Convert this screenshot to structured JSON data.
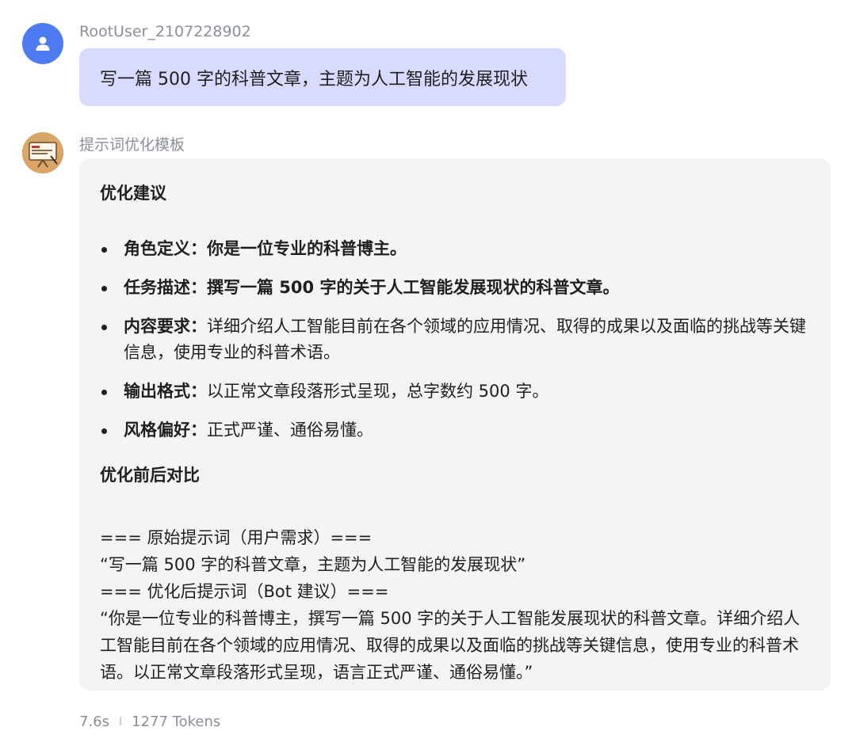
{
  "user": {
    "name": "RootUser_2107228902",
    "message": "写一篇 500 字的科普文章，主题为人工智能的发展现状"
  },
  "bot": {
    "name": "提示词优化模板",
    "section1_title": "优化建议",
    "suggestions": [
      {
        "label": "角色定义：",
        "value": "你是一位专业的科普博主。",
        "value_bold": true
      },
      {
        "label": "任务描述：",
        "value": "撰写一篇 500 字的关于人工智能发展现状的科普文章。",
        "value_bold": true
      },
      {
        "label": "内容要求：",
        "value": "详细介绍人工智能目前在各个领域的应用情况、取得的成果以及面临的挑战等关键信息，使用专业的科普术语。",
        "value_bold": false
      },
      {
        "label": "输出格式：",
        "value": "以正常文章段落形式呈现，总字数约 500 字。",
        "value_bold": false
      },
      {
        "label": "风格偏好：",
        "value": "正式严谨、通俗易懂。",
        "value_bold": false
      }
    ],
    "section2_title": "优化前后对比",
    "compare": {
      "original_header": "=== 原始提示词（用户需求）===",
      "original_text": "“写一篇 500 字的科普文章，主题为人工智能的发展现状”",
      "optimized_header": "=== 优化后提示词（Bot 建议）===",
      "optimized_text": "“你是一位专业的科普博主，撰写一篇 500 字的关于人工智能发展现状的科普文章。详细介绍人工智能目前在各个领域的应用情况、取得的成果以及面临的挑战等关键信息，使用专业的科普术语。以正常文章段落形式呈现，语言正式严谨、通俗易懂。”"
    }
  },
  "meta": {
    "time": "7.6s",
    "separator": "I",
    "tokens": "1277 Tokens"
  },
  "colors": {
    "user_avatar": "#4d7cf2",
    "user_bubble": "#d8daff",
    "bot_card": "#f3f4f6"
  },
  "icons": {
    "user_avatar": "person-icon",
    "bot_avatar": "presentation-board-icon"
  }
}
